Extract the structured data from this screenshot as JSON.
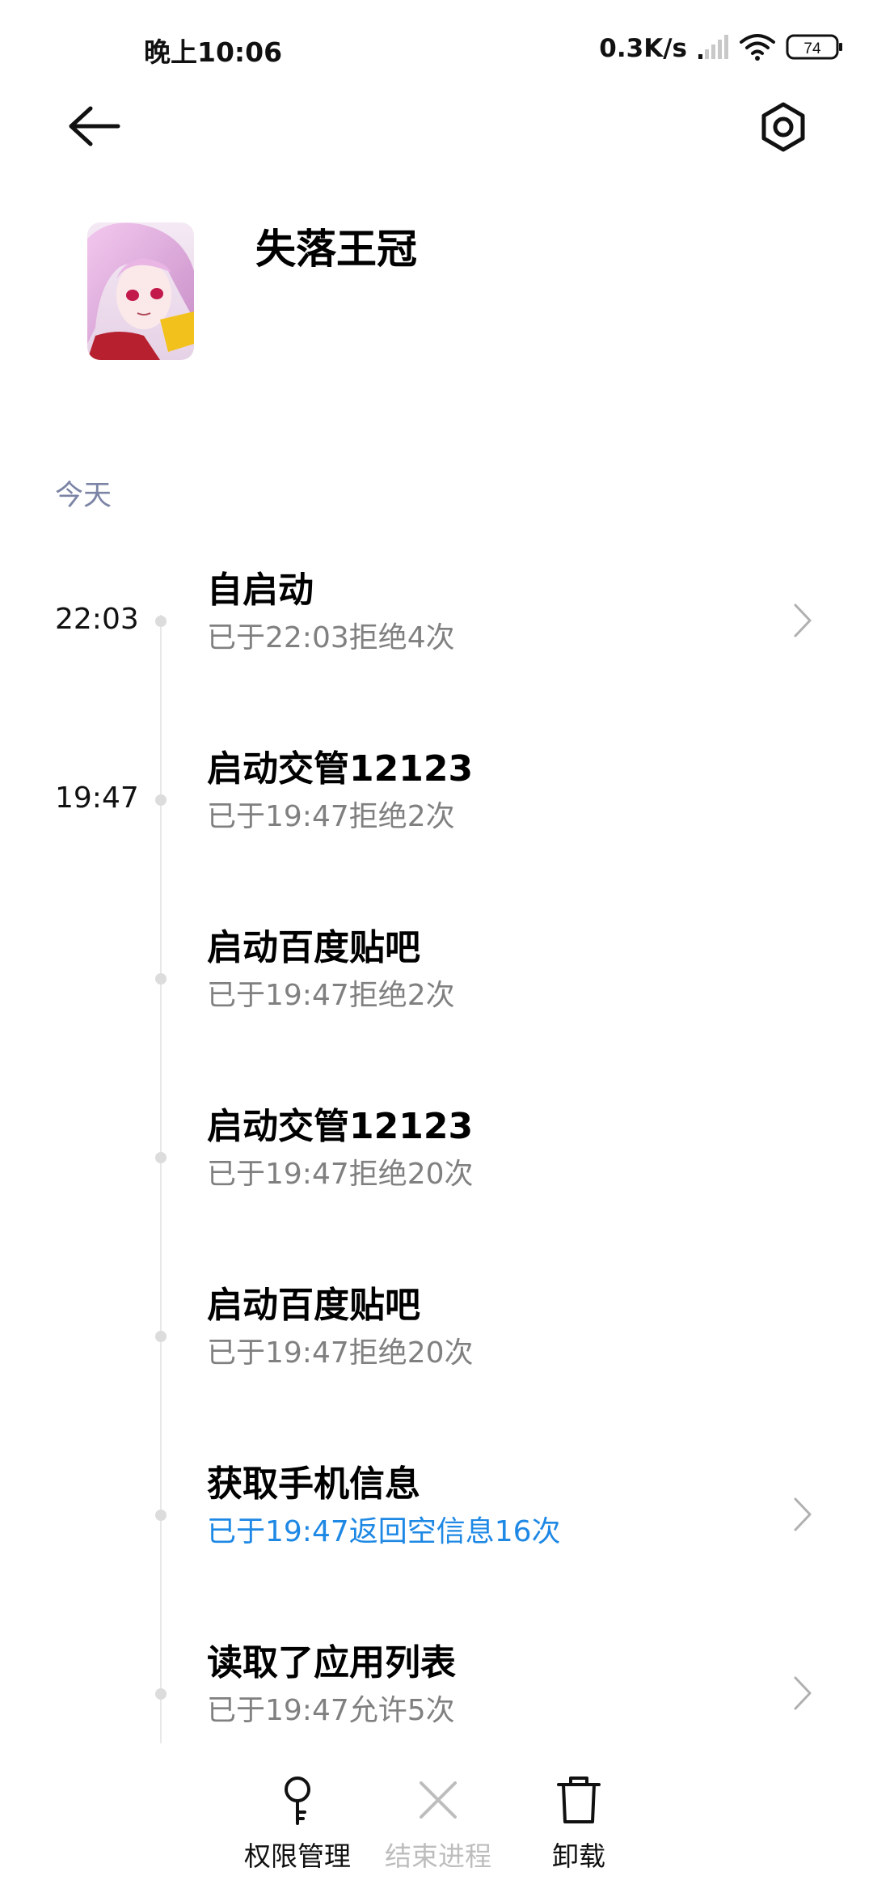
{
  "status_bar": {
    "time": "晚上10:06",
    "net_speed": "0.3K/s",
    "battery": "74",
    "icons": [
      "signal-icon",
      "wifi-icon",
      "battery-icon"
    ]
  },
  "header": {
    "back_icon": "back-arrow-icon",
    "settings_icon": "settings-icon"
  },
  "app": {
    "name": "失落王冠"
  },
  "section": {
    "today": "今天"
  },
  "events": [
    {
      "time": "22:03",
      "title": "自启动",
      "subtitle": "已于22:03拒绝4次",
      "has_chevron": true,
      "subtitle_color": "#808080"
    },
    {
      "time": "19:47",
      "title": "启动交管12123",
      "subtitle": "已于19:47拒绝2次",
      "has_chevron": false,
      "subtitle_color": "#808080"
    },
    {
      "time": "",
      "title": "启动百度贴吧",
      "subtitle": "已于19:47拒绝2次",
      "has_chevron": false,
      "subtitle_color": "#808080"
    },
    {
      "time": "",
      "title": "启动交管12123",
      "subtitle": "已于19:47拒绝20次",
      "has_chevron": false,
      "subtitle_color": "#808080"
    },
    {
      "time": "",
      "title": "启动百度贴吧",
      "subtitle": "已于19:47拒绝20次",
      "has_chevron": false,
      "subtitle_color": "#808080"
    },
    {
      "time": "",
      "title": "获取手机信息",
      "subtitle": "已于19:47返回空信息16次",
      "has_chevron": true,
      "subtitle_color": "#1e88e5"
    },
    {
      "time": "",
      "title": "读取了应用列表",
      "subtitle": "已于19:47允许5次",
      "has_chevron": true,
      "subtitle_color": "#808080"
    }
  ],
  "bottom_bar": {
    "permissions_label": "权限管理",
    "end_process_label": "结束进程",
    "uninstall_label": "卸载",
    "icons": [
      "key-icon",
      "close-icon",
      "trash-icon"
    ]
  },
  "colors": {
    "accent_blue": "#1e88e5",
    "section_header": "#7c84a6",
    "subtitle_gray": "#808080",
    "disabled_gray": "#bdbdbd"
  }
}
